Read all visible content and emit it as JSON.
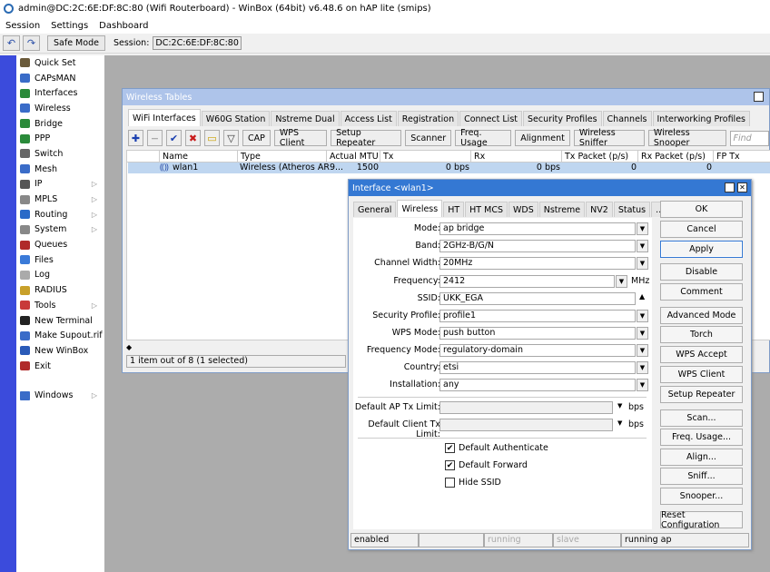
{
  "window_title": "admin@DC:2C:6E:DF:8C:80 (Wifi Routerboard) - WinBox (64bit) v6.48.6 on hAP lite (smips)",
  "menubar": [
    "Session",
    "Settings",
    "Dashboard"
  ],
  "toolbar": {
    "undo_icon": "↶",
    "redo_icon": "↷",
    "safe_mode_label": "Safe Mode",
    "session_label": "Session:",
    "session_value": "DC:2C:6E:DF:8C:80"
  },
  "sidebar": {
    "items": [
      {
        "label": "Quick Set",
        "icon": "wand-icon",
        "color": "#6a5a3a",
        "arrow": ""
      },
      {
        "label": "CAPsMAN",
        "icon": "capsman-icon",
        "color": "#3a6cc8",
        "arrow": ""
      },
      {
        "label": "Interfaces",
        "icon": "interfaces-icon",
        "color": "#2a8a3a",
        "arrow": ""
      },
      {
        "label": "Wireless",
        "icon": "wireless-icon",
        "color": "#3a6cc8",
        "arrow": ""
      },
      {
        "label": "Bridge",
        "icon": "bridge-icon",
        "color": "#2a8a3a",
        "arrow": ""
      },
      {
        "label": "PPP",
        "icon": "ppp-icon",
        "color": "#2a8a3a",
        "arrow": ""
      },
      {
        "label": "Switch",
        "icon": "switch-icon",
        "color": "#666666",
        "arrow": ""
      },
      {
        "label": "Mesh",
        "icon": "mesh-icon",
        "color": "#3a6cc8",
        "arrow": ""
      },
      {
        "label": "IP",
        "icon": "ip-icon",
        "color": "#555555",
        "arrow": "▷"
      },
      {
        "label": "MPLS",
        "icon": "mpls-icon",
        "color": "#888888",
        "arrow": "▷"
      },
      {
        "label": "Routing",
        "icon": "routing-icon",
        "color": "#2a6ac8",
        "arrow": "▷"
      },
      {
        "label": "System",
        "icon": "system-icon",
        "color": "#888888",
        "arrow": "▷"
      },
      {
        "label": "Queues",
        "icon": "queues-icon",
        "color": "#b02a2a",
        "arrow": ""
      },
      {
        "label": "Files",
        "icon": "files-icon",
        "color": "#3a7ad8",
        "arrow": ""
      },
      {
        "label": "Log",
        "icon": "log-icon",
        "color": "#aaaaaa",
        "arrow": ""
      },
      {
        "label": "RADIUS",
        "icon": "radius-icon",
        "color": "#c8a02a",
        "arrow": ""
      },
      {
        "label": "Tools",
        "icon": "tools-icon",
        "color": "#c83a3a",
        "arrow": "▷"
      },
      {
        "label": "New Terminal",
        "icon": "terminal-icon",
        "color": "#222222",
        "arrow": ""
      },
      {
        "label": "Make Supout.rif",
        "icon": "supout-icon",
        "color": "#3a6cc8",
        "arrow": ""
      },
      {
        "label": "New WinBox",
        "icon": "winbox-icon",
        "color": "#2a5ab8",
        "arrow": ""
      },
      {
        "label": "Exit",
        "icon": "exit-icon",
        "color": "#b02a2a",
        "arrow": ""
      }
    ],
    "windows_label": "Windows",
    "windows_arrow": "▷"
  },
  "wireless_tables": {
    "title": "Wireless Tables",
    "tabs": [
      "WiFi Interfaces",
      "W60G Station",
      "Nstreme Dual",
      "Access List",
      "Registration",
      "Connect List",
      "Security Profiles",
      "Channels",
      "Interworking Profiles"
    ],
    "toolbar_buttons": [
      "CAP",
      "WPS Client",
      "Setup Repeater",
      "Scanner",
      "Freq. Usage",
      "Alignment",
      "Wireless Sniffer",
      "Wireless Snooper"
    ],
    "find_placeholder": "Find",
    "columns": [
      "Name",
      "Type",
      "Actual MTU",
      "Tx",
      "Rx",
      "Tx Packet (p/s)",
      "Rx Packet (p/s)",
      "FP Tx"
    ],
    "row": {
      "name": "wlan1",
      "type": "Wireless (Atheros AR9...",
      "mtu": "1500",
      "tx": "0 bps",
      "rx": "0 bps",
      "txp": "0",
      "rxp": "0"
    },
    "status": "1 item out of 8 (1 selected)"
  },
  "interface_dialog": {
    "title": "Interface <wlan1>",
    "tabs": [
      "General",
      "Wireless",
      "HT",
      "HT MCS",
      "WDS",
      "Nstreme",
      "NV2",
      "Status",
      "..."
    ],
    "fields": {
      "mode_label": "Mode:",
      "mode": "ap bridge",
      "band_label": "Band:",
      "band": "2GHz-B/G/N",
      "width_label": "Channel Width:",
      "width": "20MHz",
      "freq_label": "Frequency:",
      "freq": "2412",
      "freq_unit": "MHz",
      "ssid_label": "SSID:",
      "ssid": "UKK_EGA",
      "secprof_label": "Security Profile:",
      "secprof": "profile1",
      "wps_label": "WPS Mode:",
      "wps": "push button",
      "freqmode_label": "Frequency Mode:",
      "freqmode": "regulatory-domain",
      "country_label": "Country:",
      "country": "etsi",
      "install_label": "Installation:",
      "install": "any",
      "aptx_label": "Default AP Tx Limit:",
      "aptx_unit": "bps",
      "cltx_label": "Default Client Tx Limit:",
      "cltx_unit": "bps"
    },
    "checkboxes": [
      {
        "label": "Default Authenticate",
        "checked": true
      },
      {
        "label": "Default Forward",
        "checked": true
      },
      {
        "label": "Hide SSID",
        "checked": false
      }
    ],
    "buttons": [
      "OK",
      "Cancel",
      "Apply",
      "Disable",
      "Comment",
      "Advanced Mode",
      "Torch",
      "WPS Accept",
      "WPS Client",
      "Setup Repeater",
      "Scan...",
      "Freq. Usage...",
      "Align...",
      "Sniff...",
      "Snooper...",
      "Reset Configuration"
    ],
    "status": [
      "enabled",
      "",
      "running",
      "slave",
      "running ap"
    ]
  }
}
